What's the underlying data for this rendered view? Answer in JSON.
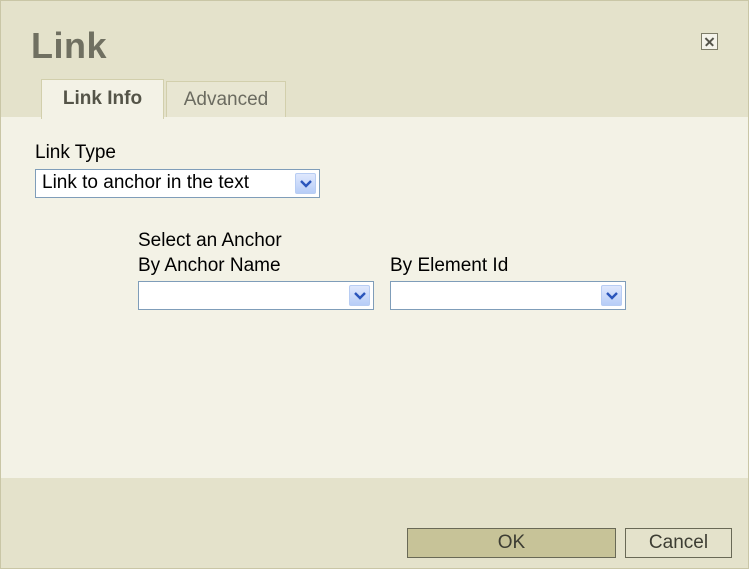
{
  "dialog": {
    "title": "Link",
    "close_icon": "close-icon"
  },
  "tabs": [
    {
      "label": "Link Info",
      "active": true
    },
    {
      "label": "Advanced",
      "active": false
    }
  ],
  "link_type": {
    "label": "Link Type",
    "value": "Link to anchor in the text"
  },
  "anchor": {
    "section_label": "Select an Anchor",
    "by_name_label": "By Anchor Name",
    "by_name_value": "",
    "by_id_label": "By Element Id",
    "by_id_value": ""
  },
  "buttons": {
    "ok": "OK",
    "cancel": "Cancel"
  },
  "colors": {
    "header_bg": "#e4e2cb",
    "body_bg": "#f3f2e6",
    "ok_bg": "#c7c398",
    "dropdown_arrow": "#2a55bb"
  }
}
